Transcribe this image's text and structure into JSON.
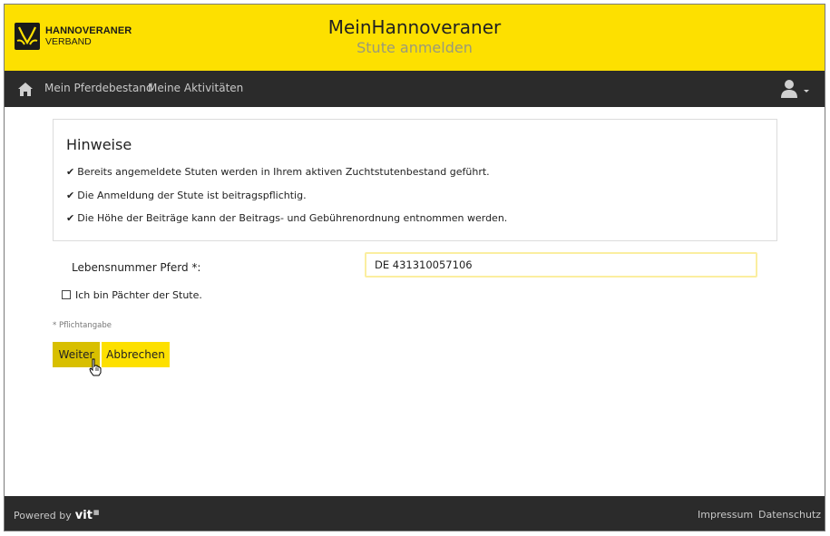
{
  "header": {
    "brand_line1": "HANNOVERANER",
    "brand_line2": "VERBAND",
    "app_title": "MeinHannoveraner",
    "page_subtitle": "Stute anmelden",
    "brand_color": "#fde000"
  },
  "nav": {
    "home_icon": "home-icon",
    "links": [
      "Mein Pferdebestand",
      "Meine Aktivitäten"
    ],
    "user_icon": "user-icon"
  },
  "hints": {
    "title": "Hinweise",
    "items": [
      "Bereits angemeldete Stuten werden in Ihrem aktiven Zuchtstutenbestand geführt.",
      "Die Anmeldung der Stute ist beitragspflichtig.",
      "Die Höhe der Beiträge kann der Beitrags- und Gebührenordnung entnommen werden."
    ],
    "check_glyph": "✔"
  },
  "form": {
    "lebensnummer_label": "Lebensnummer Pferd *:",
    "lebensnummer_value": "DE 431310057106",
    "paechter_label": "Ich bin Pächter der Stute.",
    "paechter_checked": false,
    "required_note": "* Pflichtangabe"
  },
  "buttons": {
    "weiter": "Weiter",
    "abbrechen": "Abbrechen"
  },
  "footer": {
    "powered_by": "Powered by",
    "vit_logo": "vit",
    "links": [
      "Impressum",
      "Datenschutz"
    ]
  }
}
